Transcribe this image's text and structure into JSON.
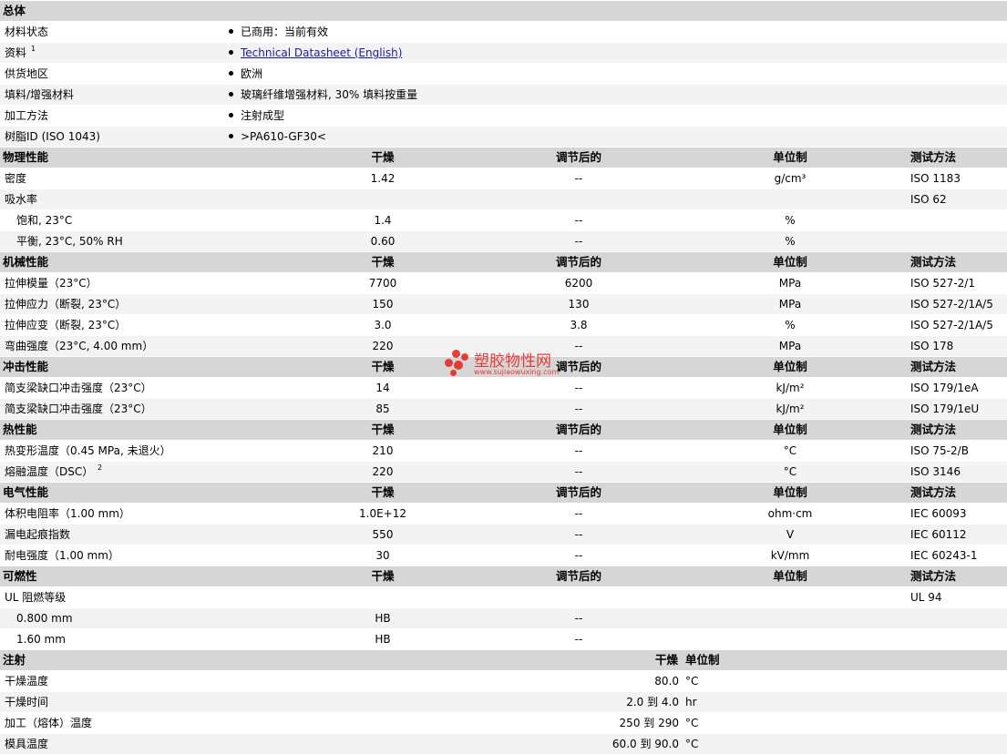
{
  "general": {
    "title": "总体",
    "rows": [
      {
        "label": "材料状态",
        "value": "已商用：当前有效"
      },
      {
        "label": "资料",
        "sup": "1",
        "value": "Technical Datasheet (English)",
        "link": true
      },
      {
        "label": "供货地区",
        "value": "欧洲"
      },
      {
        "label": "填料/增强材料",
        "value": "玻璃纤维增强材料, 30% 填料按重量"
      },
      {
        "label": "加工方法",
        "value": "注射成型"
      },
      {
        "label": "树脂ID (ISO 1043)",
        "value": ">PA610-GF30<"
      }
    ]
  },
  "columns": {
    "dry": "干燥",
    "cond": "调节后的",
    "unit": "单位制",
    "method": "测试方法"
  },
  "sections": [
    {
      "title": "物理性能",
      "rows": [
        {
          "label": "密度",
          "dry": "1.42",
          "cond": "--",
          "unit": "g/cm³",
          "method": "ISO 1183"
        },
        {
          "label": "吸水率",
          "dry": "",
          "cond": "",
          "unit": "",
          "method": "ISO 62"
        },
        {
          "label": "饱和, 23°C",
          "indent": true,
          "dry": "1.4",
          "cond": "--",
          "unit": "%",
          "method": ""
        },
        {
          "label": "平衡, 23°C, 50% RH",
          "indent": true,
          "dry": "0.60",
          "cond": "--",
          "unit": "%",
          "method": ""
        }
      ]
    },
    {
      "title": "机械性能",
      "rows": [
        {
          "label": "拉伸模量（23°C）",
          "dry": "7700",
          "cond": "6200",
          "unit": "MPa",
          "method": "ISO 527-2/1"
        },
        {
          "label": "拉伸应力（断裂, 23°C）",
          "dry": "150",
          "cond": "130",
          "unit": "MPa",
          "method": "ISO 527-2/1A/5"
        },
        {
          "label": "拉伸应变（断裂, 23°C）",
          "dry": "3.0",
          "cond": "3.8",
          "unit": "%",
          "method": "ISO 527-2/1A/5"
        },
        {
          "label": "弯曲强度（23°C, 4.00 mm）",
          "dry": "220",
          "cond": "--",
          "unit": "MPa",
          "method": "ISO 178"
        }
      ]
    },
    {
      "title": "冲击性能",
      "rows": [
        {
          "label": "简支梁缺口冲击强度（23°C）",
          "dry": "14",
          "cond": "--",
          "unit": "kJ/m²",
          "method": "ISO 179/1eA"
        },
        {
          "label": "简支梁缺口冲击强度（23°C）",
          "dry": "85",
          "cond": "--",
          "unit": "kJ/m²",
          "method": "ISO 179/1eU"
        }
      ]
    },
    {
      "title": "热性能",
      "rows": [
        {
          "label": "热变形温度（0.45 MPa, 未退火）",
          "dry": "210",
          "cond": "--",
          "unit": "°C",
          "method": "ISO 75-2/B"
        },
        {
          "label": "熔融温度（DSC）",
          "sup": "2",
          "dry": "220",
          "cond": "--",
          "unit": "°C",
          "method": "ISO 3146"
        }
      ]
    },
    {
      "title": "电气性能",
      "rows": [
        {
          "label": "体积电阻率（1.00 mm）",
          "dry": "1.0E+12",
          "cond": "--",
          "unit": "ohm·cm",
          "method": "IEC 60093"
        },
        {
          "label": "漏电起痕指数",
          "dry": "550",
          "cond": "--",
          "unit": "V",
          "method": "IEC 60112"
        },
        {
          "label": "耐电强度（1.00 mm）",
          "dry": "30",
          "cond": "--",
          "unit": "kV/mm",
          "method": "IEC 60243-1"
        }
      ]
    },
    {
      "title": "可燃性",
      "rows": [
        {
          "label": "UL 阻燃等级",
          "dry": "",
          "cond": "",
          "unit": "",
          "method": "UL 94"
        },
        {
          "label": "0.800 mm",
          "indent": true,
          "dry": "HB",
          "cond": "--",
          "unit": "",
          "method": ""
        },
        {
          "label": "1.60 mm",
          "indent": true,
          "dry": "HB",
          "cond": "--",
          "unit": "",
          "method": ""
        }
      ]
    }
  ],
  "injection": {
    "title": "注射",
    "col_dry": "干燥",
    "col_unit": "单位制",
    "rows": [
      {
        "label": "干燥温度",
        "value": "80.0",
        "unit": "°C"
      },
      {
        "label": "干燥时间",
        "value": "2.0 到  4.0",
        "unit": "hr"
      },
      {
        "label": "加工（熔体）温度",
        "value": "250 到  290",
        "unit": "°C"
      },
      {
        "label": "模具温度",
        "value": "60.0 到  90.0",
        "unit": "°C"
      }
    ]
  },
  "watermark": {
    "text": "塑胶物性网",
    "url": "www.sujiaowuxing.com",
    "color": "#e8201c"
  }
}
